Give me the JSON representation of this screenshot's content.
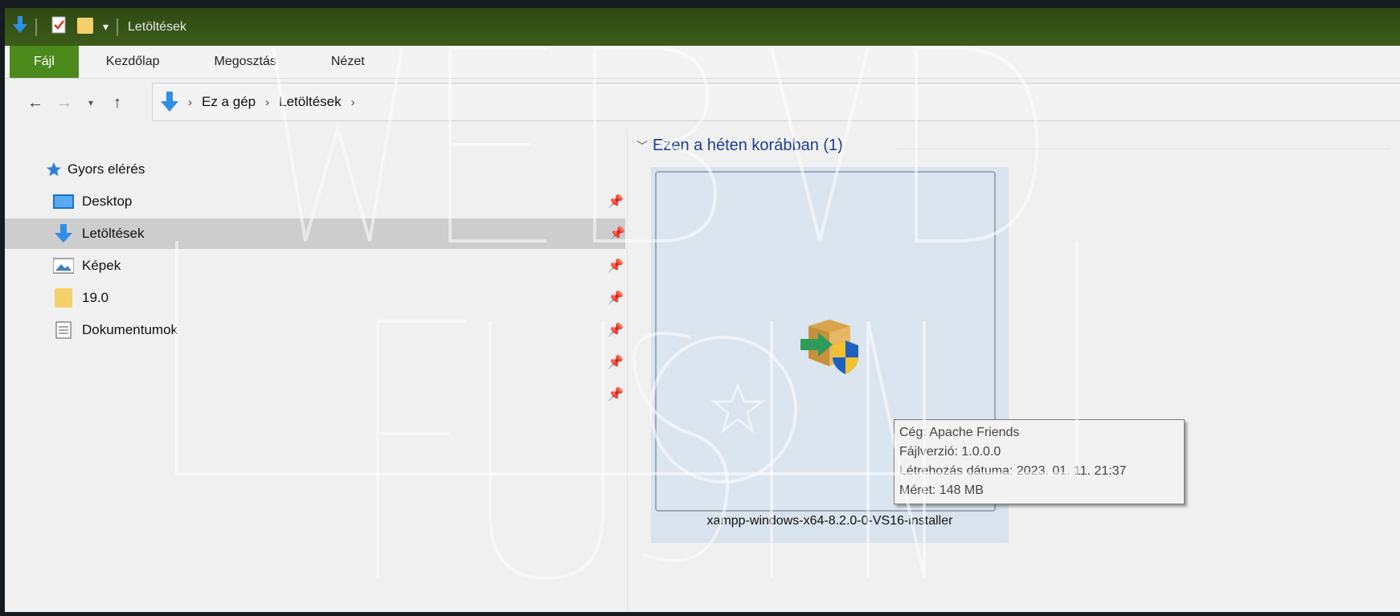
{
  "title_bar": {
    "title": "Letöltések"
  },
  "ribbon": {
    "tabs": [
      "Fájl",
      "Kezdőlap",
      "Megosztás",
      "Nézet"
    ]
  },
  "address_bar": {
    "breadcrumbs": [
      "Ez a gép",
      "Letöltések"
    ]
  },
  "nav_pane": {
    "quick_access": "Gyors elérés",
    "items": [
      {
        "label": "Desktop",
        "icon": "desktop-icon"
      },
      {
        "label": "Letöltések",
        "icon": "download-icon"
      },
      {
        "label": "Képek",
        "icon": "pictures-icon"
      },
      {
        "label": "19.0",
        "icon": "folder-icon"
      },
      {
        "label": "Dokumentumok",
        "icon": "documents-icon"
      }
    ]
  },
  "content": {
    "group_header": "Ezen a héten korábban (1)",
    "file_name": "xampp-windows-x64-8.2.0-0-VS16-installer",
    "tooltip": [
      "Cég: Apache Friends",
      "Fájlverzió: 1.0.0.0",
      "Létrehozás dátuma: 2023. 01. 11. 21:37",
      "Méret: 148 MB"
    ]
  },
  "colors": {
    "title_bar": "#3c5b18",
    "active_tab": "#4c8a1c",
    "selection": "#d9e3ee",
    "header_text": "#1e3e8a"
  }
}
